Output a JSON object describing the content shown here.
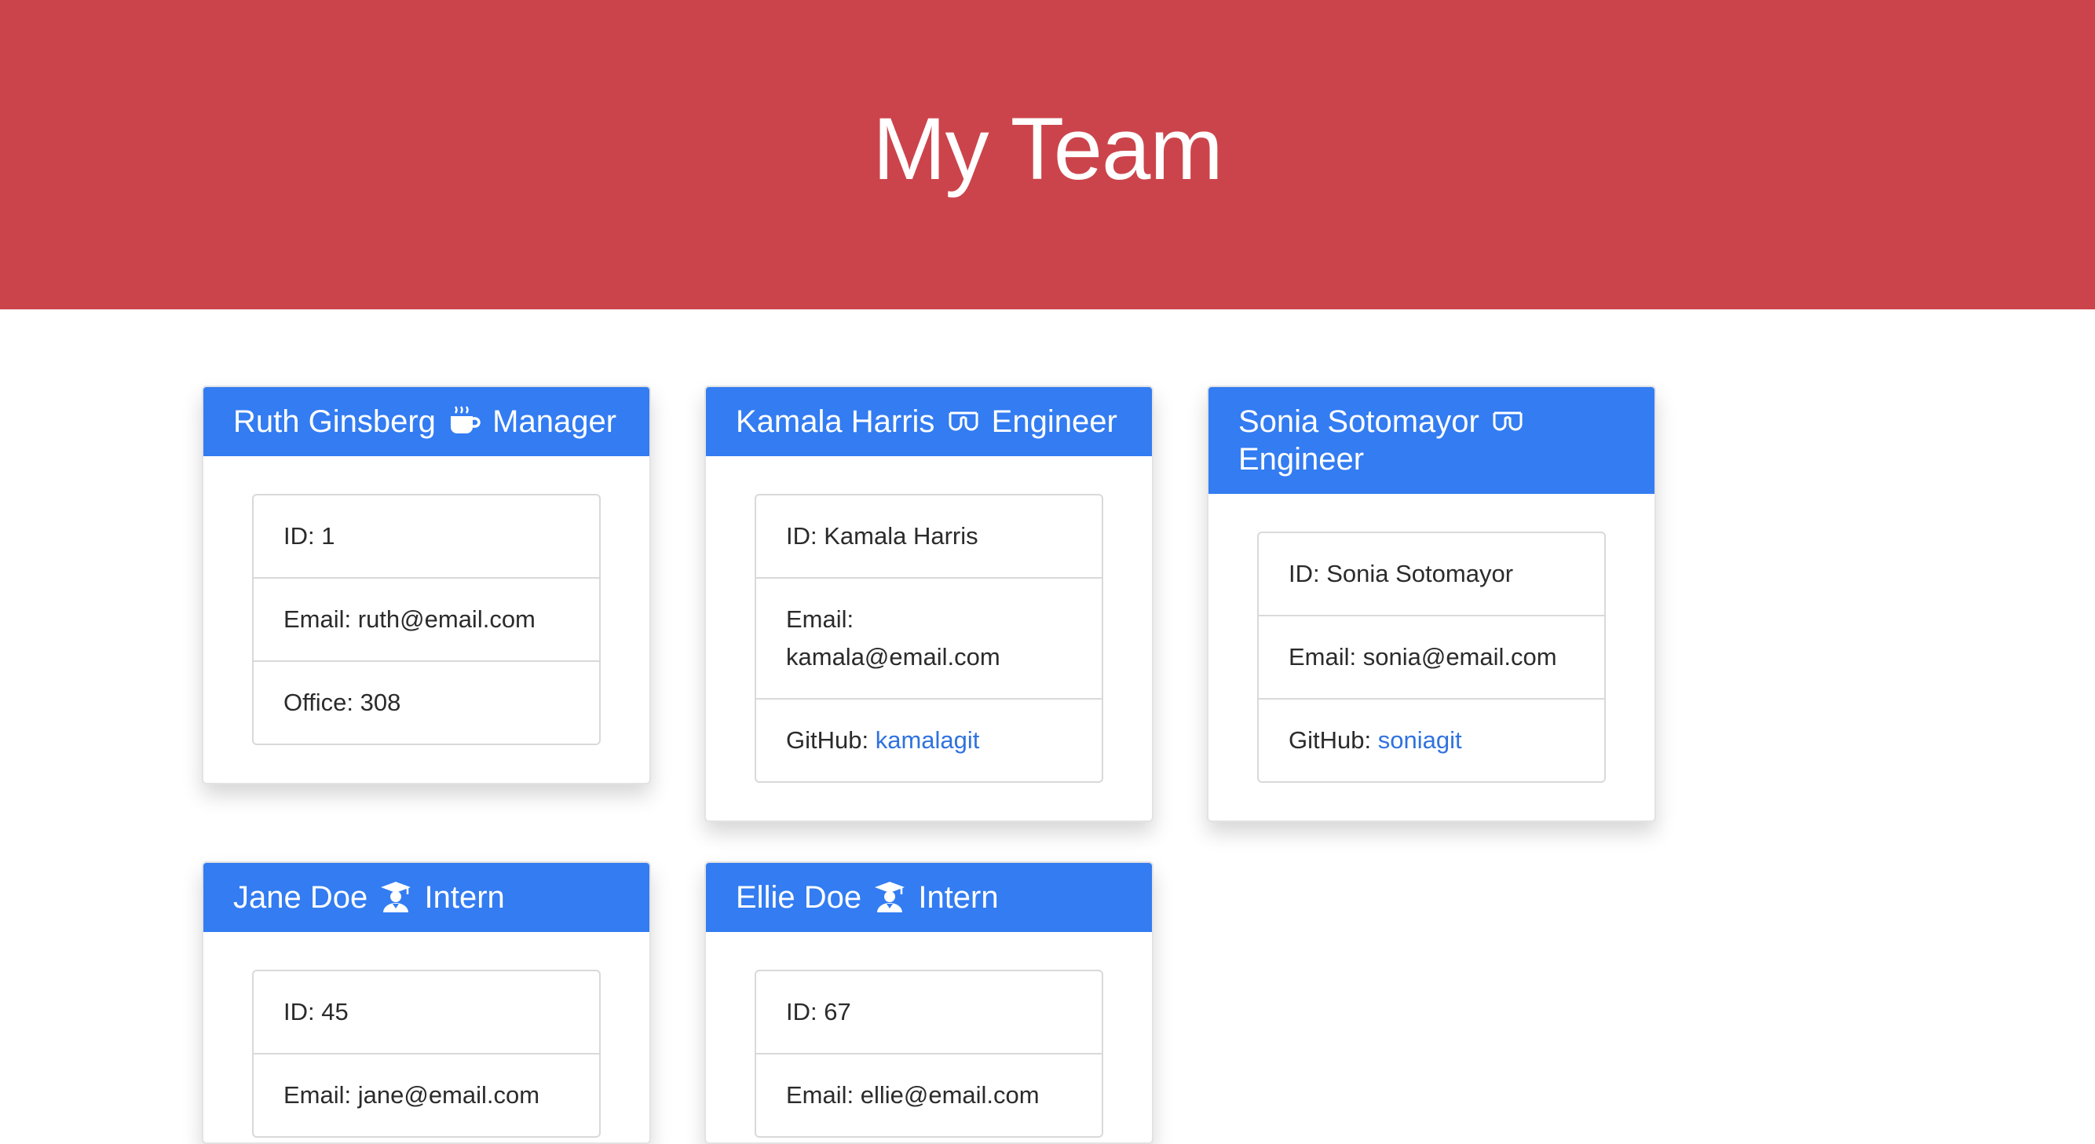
{
  "header": {
    "title": "My Team"
  },
  "colors": {
    "header_bg": "#cc444b",
    "card_header_bg": "#337cf2",
    "link": "#2f72e0"
  },
  "team": [
    {
      "name": "Ruth Ginsberg",
      "role": "Manager",
      "icon": "coffee-mug-icon",
      "id_label": "ID: 1",
      "email_label": "Email: ruth@email.com",
      "extra_label": "Office: 308"
    },
    {
      "name": "Kamala Harris",
      "role": "Engineer",
      "icon": "glasses-icon",
      "id_label": "ID: Kamala Harris",
      "email_label": "Email: kamala@email.com",
      "github_prefix": "GitHub: ",
      "github": "kamalagit"
    },
    {
      "name": "Sonia Sotomayor",
      "role": "Engineer",
      "icon": "glasses-icon",
      "id_label": "ID: Sonia Sotomayor",
      "email_label": "Email: sonia@email.com",
      "github_prefix": "GitHub: ",
      "github": "soniagit"
    },
    {
      "name": "Jane Doe",
      "role": "Intern",
      "icon": "graduate-icon",
      "id_label": "ID: 45",
      "email_label": "Email: jane@email.com"
    },
    {
      "name": "Ellie Doe",
      "role": "Intern",
      "icon": "graduate-icon",
      "id_label": "ID: 67",
      "email_label": "Email: ellie@email.com"
    }
  ]
}
